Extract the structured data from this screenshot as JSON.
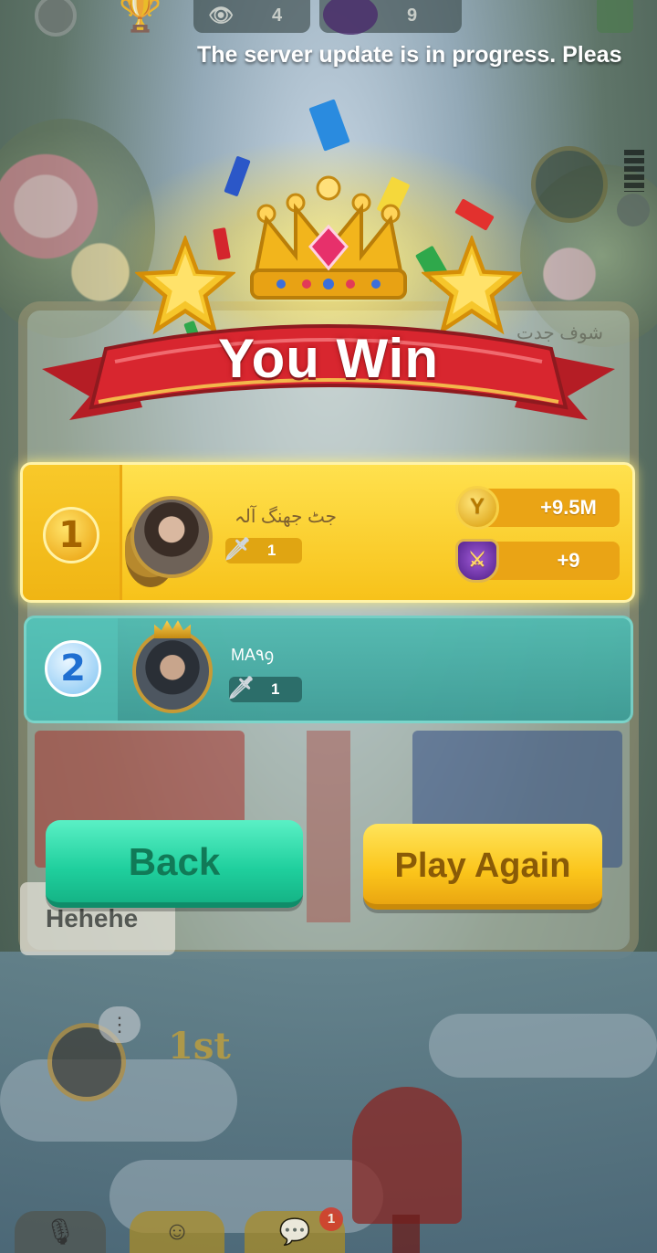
{
  "hud": {
    "viewers": "4",
    "rank_points": "9"
  },
  "notice": "The server update is in progress. Pleas",
  "result": {
    "title": "You Win"
  },
  "players": [
    {
      "rank": "1",
      "name": "جٹ جھنگ آلہ",
      "swords": "1",
      "coins_reward": "+9.5M",
      "rank_reward": "+9"
    },
    {
      "rank": "2",
      "name": "MA٩ꝯ",
      "swords": "1"
    }
  ],
  "buttons": {
    "back": "Back",
    "play_again": "Play Again"
  },
  "background": {
    "opponent_name": "شوف جدت",
    "chat_message": "Hehehe",
    "my_place": "1st",
    "chat_badge": "1"
  },
  "colors": {
    "winner_card": "#f7c21a",
    "second_card": "#3a9c96",
    "back_button": "#1fcf9d",
    "play_again_button": "#fbc51b",
    "ribbon": "#d8262f"
  },
  "icons": [
    "gear-icon",
    "trophy-icon",
    "eye-icon",
    "sword-icon",
    "crown-icon",
    "star-icon",
    "coin-icon",
    "rank-shield-icon",
    "mic-icon",
    "emoji-icon",
    "chat-icon",
    "more-icon"
  ]
}
